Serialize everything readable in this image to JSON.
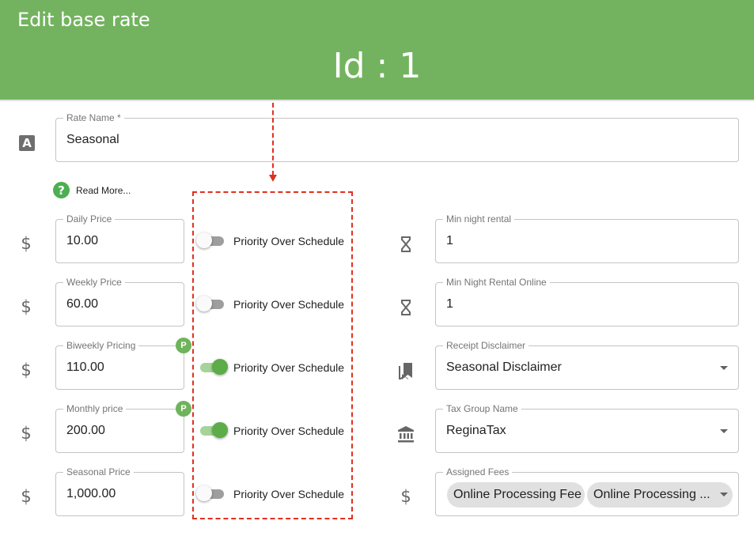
{
  "header": {
    "title": "Edit base rate",
    "id_text": "Id : 1"
  },
  "rate_name": {
    "label": "Rate Name *",
    "value": "Seasonal"
  },
  "help": {
    "text": "Read More..."
  },
  "price_rows": [
    {
      "label": "Daily Price",
      "value": "10.00",
      "priority": false,
      "badge": "",
      "toggle_label": "Priority Over Schedule"
    },
    {
      "label": "Weekly Price",
      "value": "60.00",
      "priority": false,
      "badge": "",
      "toggle_label": "Priority Over Schedule"
    },
    {
      "label": "Biweekly Pricing",
      "value": "110.00",
      "priority": true,
      "badge": "P",
      "toggle_label": "Priority Over Schedule"
    },
    {
      "label": "Monthly price",
      "value": "200.00",
      "priority": true,
      "badge": "P",
      "toggle_label": "Priority Over Schedule"
    },
    {
      "label": "Seasonal Price",
      "value": "1,000.00",
      "priority": false,
      "badge": "",
      "toggle_label": "Priority Over Schedule"
    }
  ],
  "right_fields": [
    {
      "label": "Min night rental",
      "value": "1",
      "icon": "hourglass-icon"
    },
    {
      "label": "Min Night Rental Online",
      "value": "1",
      "icon": "hourglass-icon"
    },
    {
      "label": "Receipt Disclaimer",
      "value": "Seasonal Disclaimer",
      "icon": "bookmarks-icon",
      "dropdown": true
    },
    {
      "label": "Tax Group Name",
      "value": "ReginaTax",
      "icon": "bank-icon",
      "dropdown": true
    }
  ],
  "assigned_fees": {
    "label": "Assigned Fees",
    "chips": [
      "Online Processing Fee",
      "Online Processing ..."
    ]
  },
  "colors": {
    "header": "#73b35f",
    "toggle_on": "#5cac47",
    "annotation": "#e0301e"
  }
}
